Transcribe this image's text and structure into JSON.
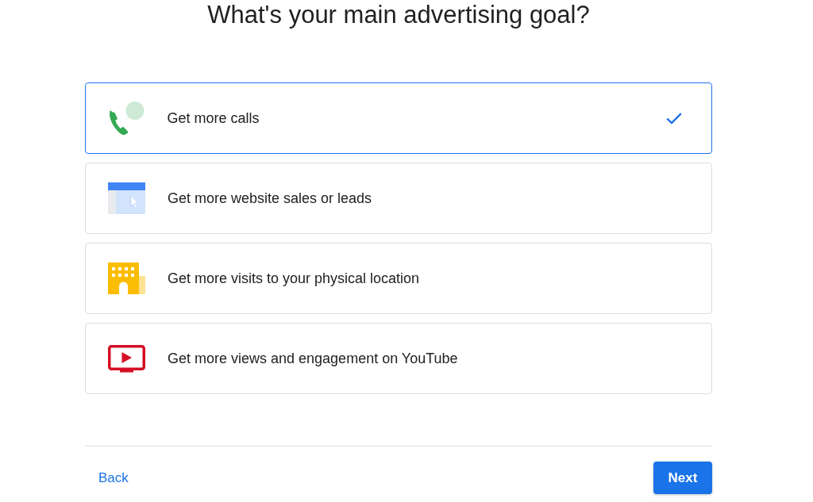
{
  "heading": "What's your main advertising goal?",
  "goals": [
    {
      "kind": "calls",
      "label": "Get more calls",
      "selected": true
    },
    {
      "kind": "website",
      "label": "Get more website sales or leads",
      "selected": false
    },
    {
      "kind": "visits",
      "label": "Get more visits to your physical location",
      "selected": false
    },
    {
      "kind": "video",
      "label": "Get more views and engagement on YouTube",
      "selected": false
    }
  ],
  "footer": {
    "back": "Back",
    "next": "Next"
  }
}
